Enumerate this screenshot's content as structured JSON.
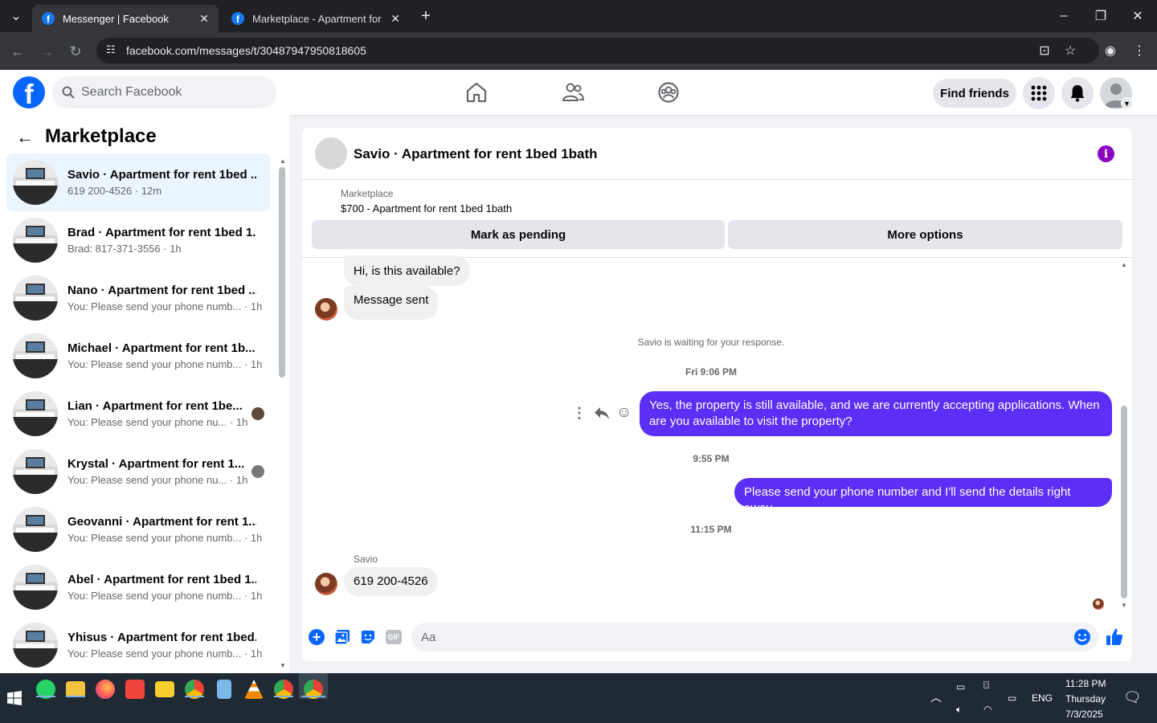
{
  "browser": {
    "tabs": [
      {
        "title": "Messenger | Facebook",
        "active": true
      },
      {
        "title": "Marketplace - Apartment for re",
        "active": false
      }
    ],
    "url": "facebook.com/messages/t/30487947950818605"
  },
  "fb_header": {
    "search_placeholder": "Search Facebook",
    "find_friends": "Find friends"
  },
  "sidebar": {
    "title": "Marketplace",
    "conversations": [
      {
        "name": "Savio · Apartment for rent 1bed ...",
        "sub": "619 200-4526 · 12m",
        "selected": true
      },
      {
        "name": "Brad · Apartment for rent 1bed 1...",
        "sub": "Brad: 817-371-3556 · 1h"
      },
      {
        "name": "Nano · Apartment for rent 1bed ...",
        "sub": "You: Please send your phone numb... · 1h"
      },
      {
        "name": "Michael · Apartment for rent 1b...",
        "sub": "You: Please send your phone numb... · 1h"
      },
      {
        "name": "Lian · Apartment for rent 1be...",
        "sub": "You: Please send your phone nu... · 1h"
      },
      {
        "name": "Krystal · Apartment for rent 1...",
        "sub": "You: Please send your phone nu... · 1h"
      },
      {
        "name": "Geovanni · Apartment for rent 1...",
        "sub": "You: Please send your phone numb... · 1h"
      },
      {
        "name": "Abel · Apartment for rent 1bed 1...",
        "sub": "You: Please send your phone numb... · 1h"
      },
      {
        "name": "Yhisus · Apartment for rent 1bed...",
        "sub": "You: Please send your phone numb... · 1h"
      }
    ]
  },
  "chat": {
    "title": "Savio · Apartment for rent 1bed 1bath",
    "listing_label": "Marketplace",
    "listing_title": "$700 - Apartment for rent 1bed 1bath",
    "mark_pending": "Mark as pending",
    "more_options": "More options",
    "msg1": "Hi, is this available?",
    "msg2": "Message sent",
    "waiting": "Savio is waiting for your response.",
    "ts1": "Fri 9:06 PM",
    "out1": "Yes, the property is still available, and we are currently accepting applications. When are you available to visit the property?",
    "ts2": "9:55 PM",
    "out2": "Please send your phone number and I'll send the details right away.",
    "ts3": "11:15 PM",
    "sender": "Savio",
    "msg3": "619 200-4526",
    "input_placeholder": "Aa"
  },
  "taskbar": {
    "time": "11:28 PM",
    "day": "Thursday",
    "date": "7/3/2025",
    "lang": "ENG"
  },
  "colors": {
    "fb_blue": "#0866ff",
    "outgoing_bubble": "#5b2ff5",
    "info_purple": "#8a05be"
  }
}
